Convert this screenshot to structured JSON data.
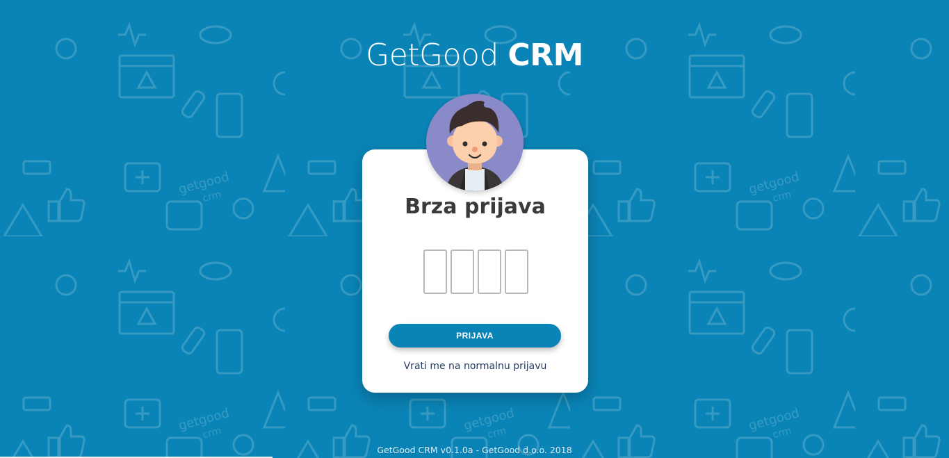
{
  "brand": {
    "name_light": "GetGood",
    "name_bold": "CRM"
  },
  "login_card": {
    "title": "Brza prijava",
    "pin_length": 4,
    "submit_label": "PRIJAVA",
    "back_link": "Vrati me na normalnu prijavu"
  },
  "footer": {
    "text": "GetGood CRM v0.1.0a - GetGood d.o.o. 2018"
  },
  "colors": {
    "background": "#0a84b6",
    "card": "#ffffff",
    "button": "#0a84b6",
    "avatar_bg": "#8b8ac9",
    "link": "#243a5e"
  },
  "icons": [
    "user-avatar"
  ]
}
